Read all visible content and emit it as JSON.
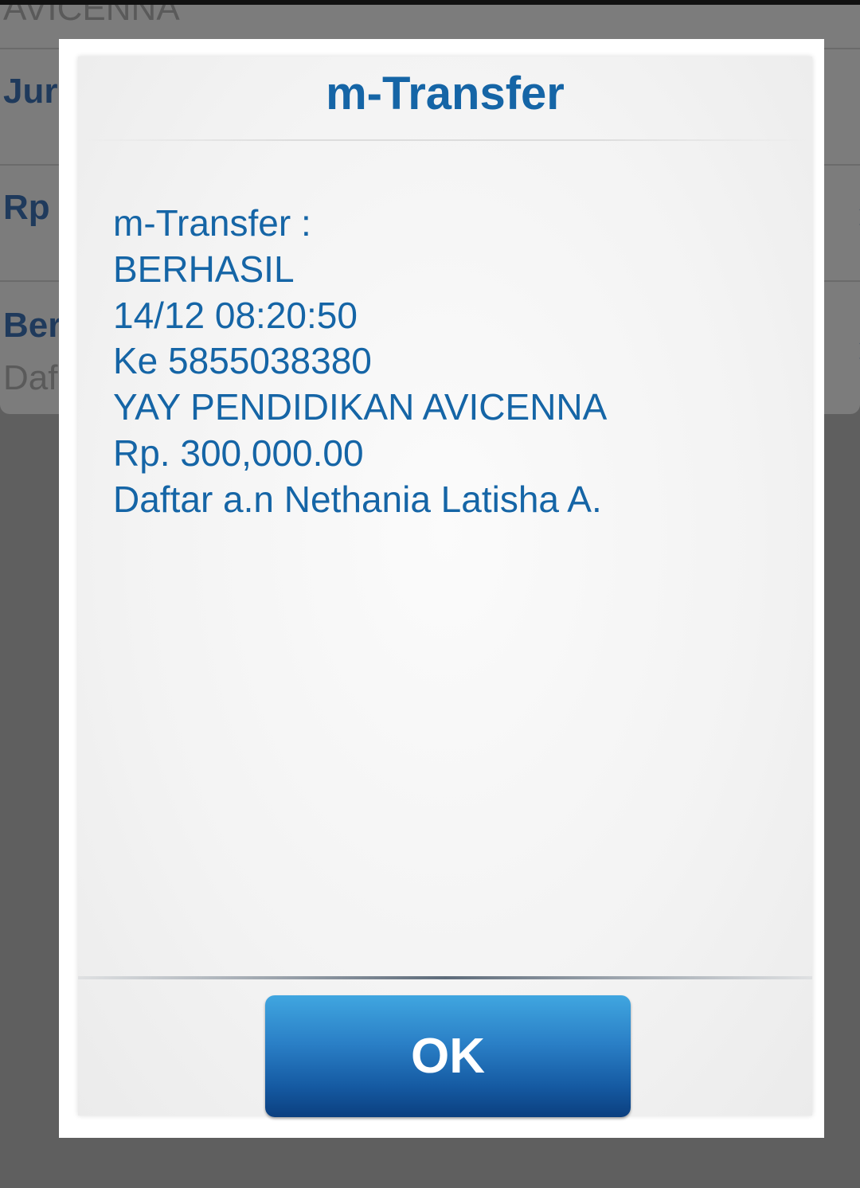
{
  "background": {
    "top_text": "AVICENNA",
    "rows": [
      {
        "label": "Jur"
      },
      {
        "label": "Rp"
      },
      {
        "label": "Ber",
        "sublabel": "Daf"
      }
    ],
    "chevron": "›"
  },
  "dialog": {
    "title": "m-Transfer",
    "lines": [
      "m-Transfer :",
      "BERHASIL",
      "14/12 08:20:50",
      "Ke 5855038380",
      "YAY PENDIDIKAN AVICENNA",
      "Rp. 300,000.00",
      "Daftar a.n Nethania Latisha A."
    ],
    "ok_label": "OK"
  },
  "colors": {
    "accent_text": "#1565a6",
    "button_top": "#40a6e0",
    "button_bottom": "#0b3f7f",
    "overlay": "#5f5f5f"
  }
}
